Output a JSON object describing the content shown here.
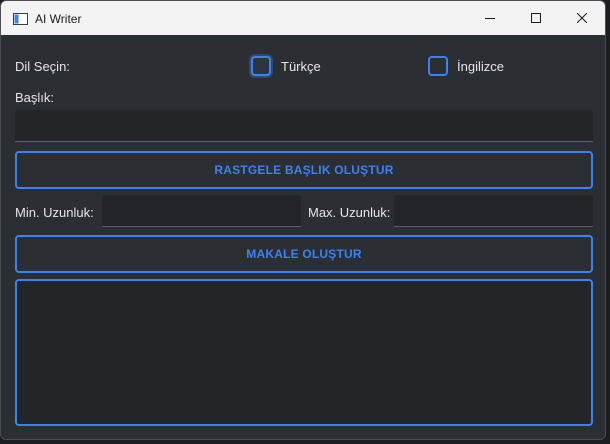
{
  "window": {
    "title": "AI Writer"
  },
  "language": {
    "label": "Dil Seçin:",
    "options": [
      {
        "label": "Türkçe",
        "checked": false,
        "focused": true
      },
      {
        "label": "İngilizce",
        "checked": false,
        "focused": false
      }
    ]
  },
  "title_field": {
    "label": "Başlık:",
    "value": ""
  },
  "random_title_button": "RASTGELE BAŞLIK OLUŞTUR",
  "length": {
    "min_label": "Min. Uzunluk:",
    "min_value": "",
    "max_label": "Max. Uzunluk:",
    "max_value": ""
  },
  "generate_article_button": "MAKALE OLUŞTUR",
  "output": {
    "text": ""
  },
  "colors": {
    "accent": "#3b82f6",
    "background": "#2b2e33",
    "field": "#232529"
  }
}
